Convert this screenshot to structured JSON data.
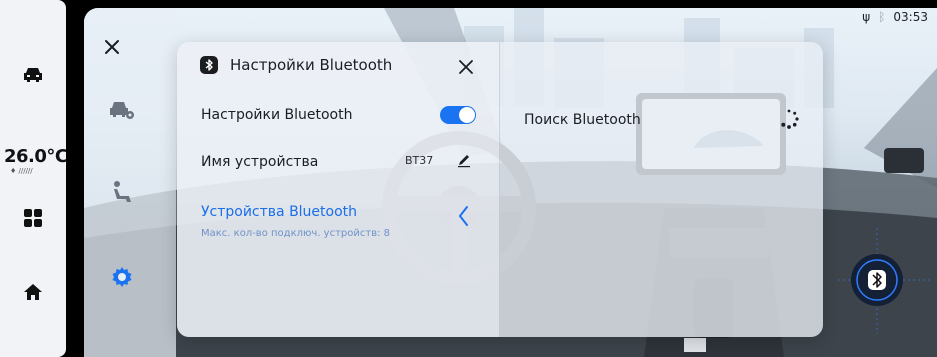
{
  "status_bar": {
    "time": "03:53",
    "usb_icon": "usb-icon",
    "bluetooth_icon": "bluetooth-icon"
  },
  "dock": {
    "temperature": "26.0°C",
    "fan_indicator": "♦ //////",
    "items": [
      {
        "name": "car-icon"
      },
      {
        "name": "apps-grid-icon"
      },
      {
        "name": "home-icon"
      }
    ]
  },
  "settings_nav": {
    "items": [
      {
        "name": "car-settings-icon"
      },
      {
        "name": "seat-icon"
      },
      {
        "name": "gear-icon",
        "active": true
      }
    ]
  },
  "bt_panel": {
    "title": "Настройки Bluetooth",
    "toggle_label": "Настройки Bluetooth",
    "toggle_on": true,
    "device_name_label": "Имя устройства",
    "device_name_value": "BT37",
    "devices_label": "Устройства Bluetooth",
    "devices_subtitle": "Макс. кол-во подключ. устройств: 8",
    "search_label": "Поиск Bluetooth"
  },
  "colors": {
    "accent": "#1a73f0",
    "link": "#1a6ee8",
    "subtitle": "#6f93c9",
    "active_nav": "#1a73f0"
  }
}
